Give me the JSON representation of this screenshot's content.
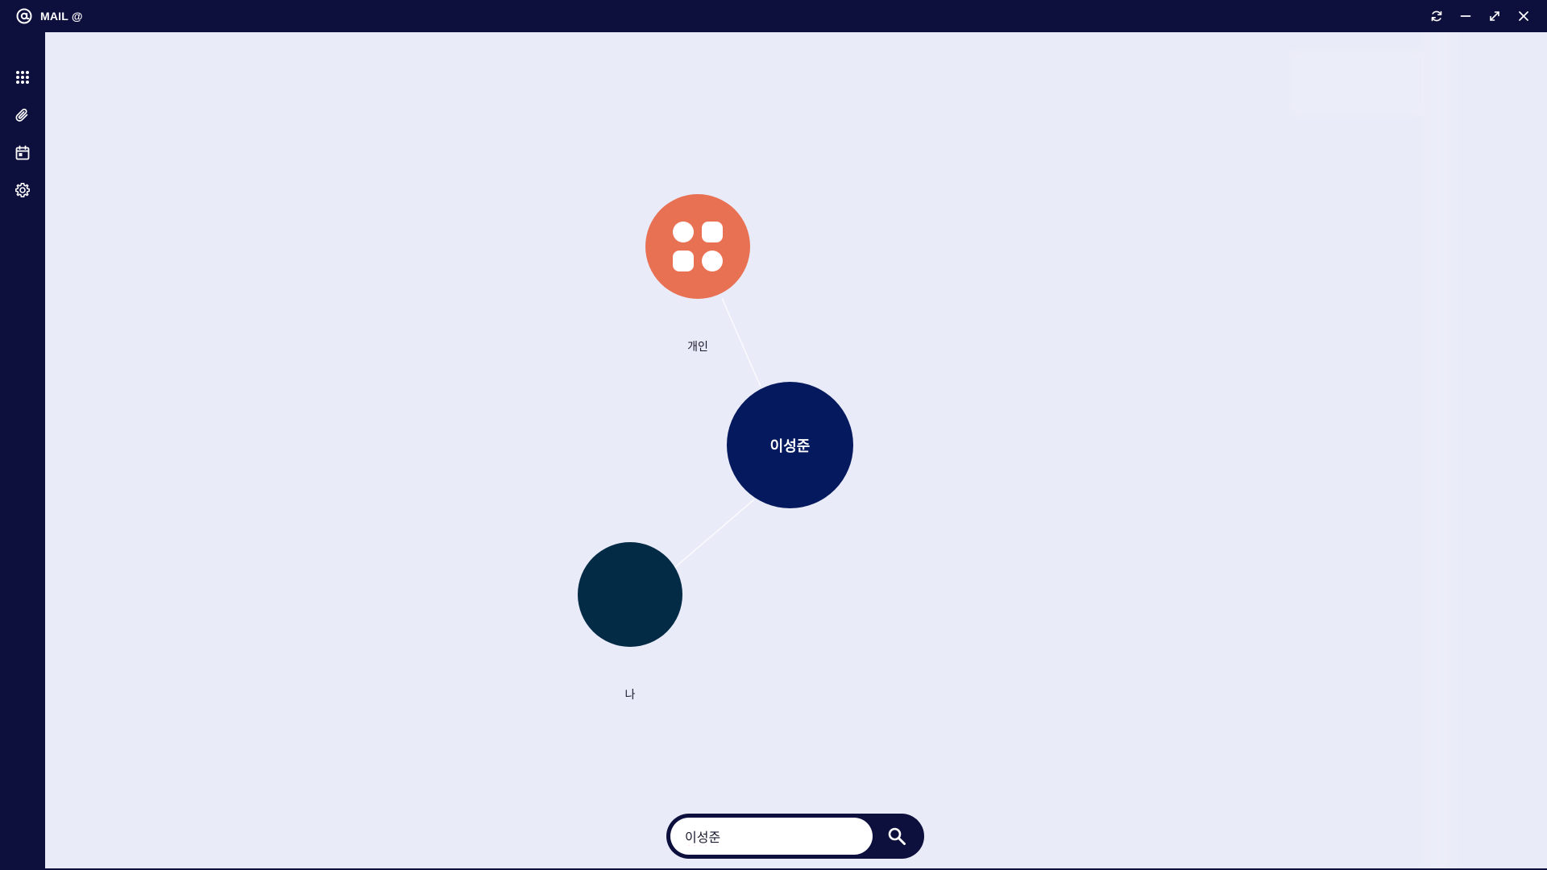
{
  "app": {
    "title": "MAIL @",
    "logo_icon": "at-sign-logo-icon"
  },
  "window_controls": [
    {
      "name": "refresh-icon"
    },
    {
      "name": "minimize-icon"
    },
    {
      "name": "maximize-icon"
    },
    {
      "name": "close-icon"
    }
  ],
  "sidebar": {
    "items": [
      {
        "icon": "apps-grid-icon"
      },
      {
        "icon": "paperclip-icon"
      },
      {
        "icon": "calendar-icon"
      },
      {
        "icon": "gear-icon"
      }
    ]
  },
  "graph": {
    "nodes": {
      "personal": {
        "label": "개인",
        "icon": "apps-icon",
        "color": "#e87153"
      },
      "center": {
        "label": "이성준",
        "color": "#051a5e"
      },
      "me": {
        "label": "나",
        "color": "#032b45"
      }
    }
  },
  "search": {
    "value": "이성준",
    "button_icon": "search-icon"
  },
  "colors": {
    "background": "#e9ebf8",
    "chrome": "#0d0f3d"
  }
}
